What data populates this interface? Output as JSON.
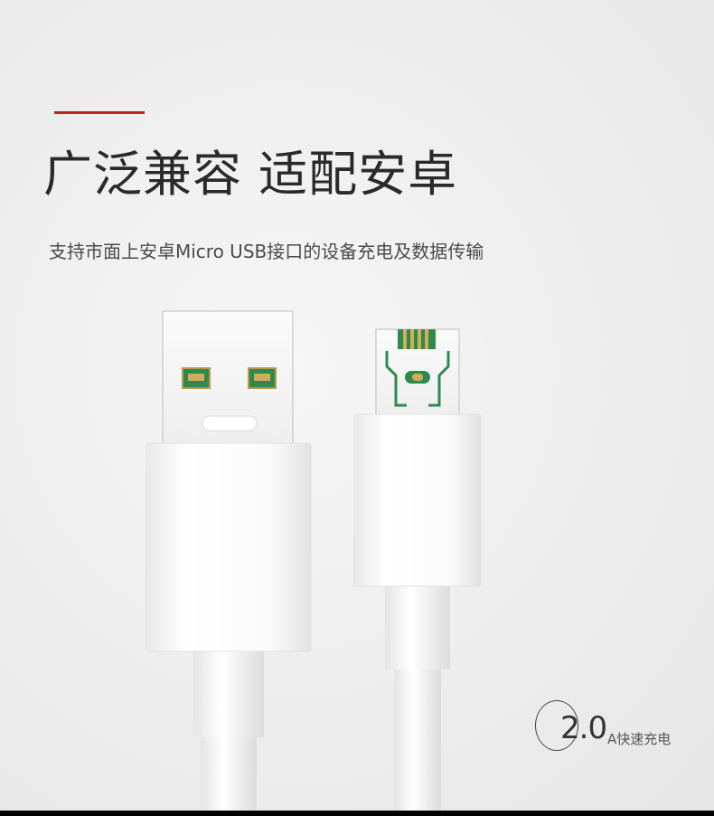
{
  "hero": {
    "headline": "广泛兼容 适配安卓",
    "subline": "支持市面上安卓Micro USB接口的设备充电及数据传输"
  },
  "badge": {
    "value": "2.0",
    "label": "A快速充电"
  },
  "colors": {
    "accent": "#c0242a",
    "background": "#eeeeee",
    "contact_green": "#1f8a4a",
    "contact_gold": "#c8a24a"
  },
  "icons": {
    "usb_a": "usb-a-plug",
    "micro_usb": "micro-usb-plug"
  }
}
